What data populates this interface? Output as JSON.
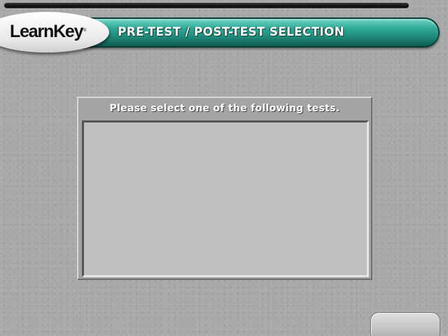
{
  "header": {
    "logo_text": "LearnKey",
    "logo_trademark": "®",
    "title": "PRE-TEST / POST-TEST SELECTION"
  },
  "dialog": {
    "prompt": "Please select one of the following tests.",
    "tests": []
  },
  "colors": {
    "banner_accent": "#1d8576",
    "background": "#a9a9a9",
    "list_background": "#bfbfbf"
  }
}
